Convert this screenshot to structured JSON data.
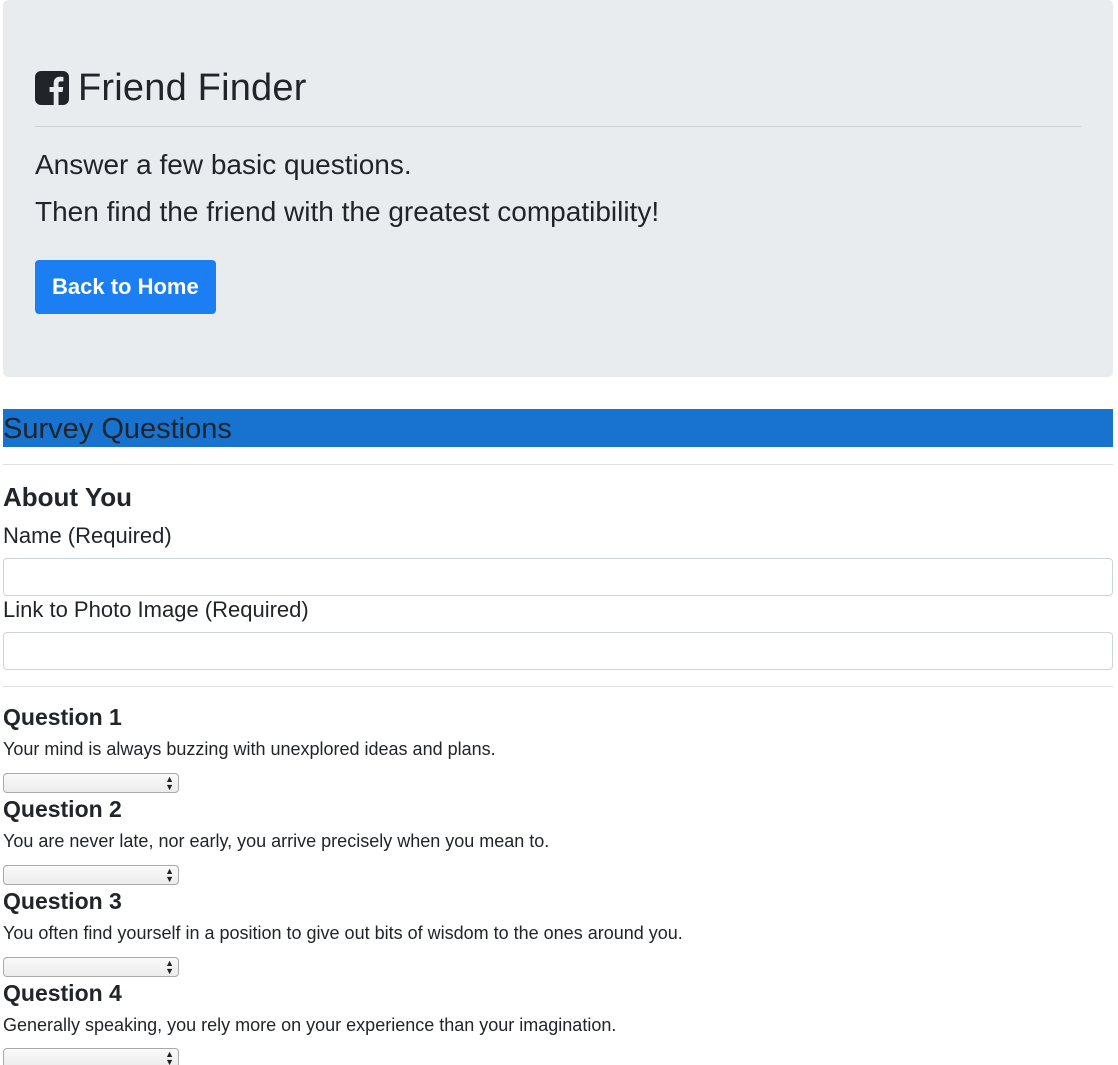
{
  "header": {
    "title": "Friend Finder",
    "lead_line1": "Answer a few basic questions.",
    "lead_line2": "Then find the friend with the greatest compatibility!",
    "home_button": "Back to Home",
    "icon": "facebook-square-icon"
  },
  "survey": {
    "heading": "Survey Questions",
    "about_heading": "About You",
    "name_label": "Name (Required)",
    "name_value": "",
    "photo_label": "Link to Photo Image (Required)",
    "photo_value": "",
    "questions": [
      {
        "title": "Question 1",
        "text": "Your mind is always buzzing with unexplored ideas and plans.",
        "selected": ""
      },
      {
        "title": "Question 2",
        "text": "You are never late, nor early, you arrive precisely when you mean to.",
        "selected": ""
      },
      {
        "title": "Question 3",
        "text": "You often find yourself in a position to give out bits of wisdom to the ones around you.",
        "selected": ""
      },
      {
        "title": "Question 4",
        "text": "Generally speaking, you rely more on your experience than your imagination.",
        "selected": ""
      }
    ]
  },
  "colors": {
    "jumbotron_bg": "#e9ecef",
    "primary_button": "#1b7ef2",
    "survey_bar": "#1772d0"
  }
}
